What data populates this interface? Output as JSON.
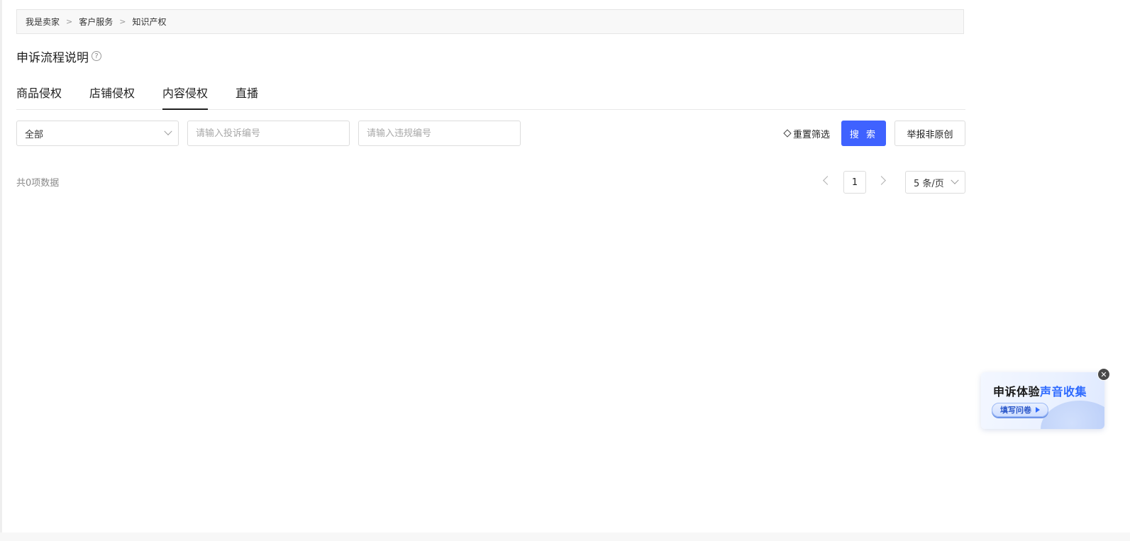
{
  "breadcrumb": {
    "items": [
      "我是卖家",
      "客户服务",
      "知识产权"
    ],
    "separator": ">"
  },
  "page": {
    "title": "申诉流程说明",
    "help_icon": "?"
  },
  "tabs": [
    {
      "label": "商品侵权",
      "active": false
    },
    {
      "label": "店铺侵权",
      "active": false
    },
    {
      "label": "内容侵权",
      "active": true
    },
    {
      "label": "直播",
      "active": false
    }
  ],
  "filters": {
    "category_select": {
      "value": "全部"
    },
    "complaint_input": {
      "placeholder": "请输入投诉编号",
      "value": ""
    },
    "violation_input": {
      "placeholder": "请输入违规编号",
      "value": ""
    },
    "reset_label": "重置筛选",
    "search_label": "搜 索",
    "report_label": "举报非原创"
  },
  "results": {
    "total_text": "共0项数据"
  },
  "pagination": {
    "current_page": "1",
    "page_size": "5 条/页"
  },
  "survey": {
    "title_plain": "申诉体验",
    "title_highlight": "声音收集",
    "button_label": "填写问卷",
    "close_symbol": "✕"
  },
  "colors": {
    "primary": "#3f62ff",
    "highlight": "#2f6bff"
  }
}
